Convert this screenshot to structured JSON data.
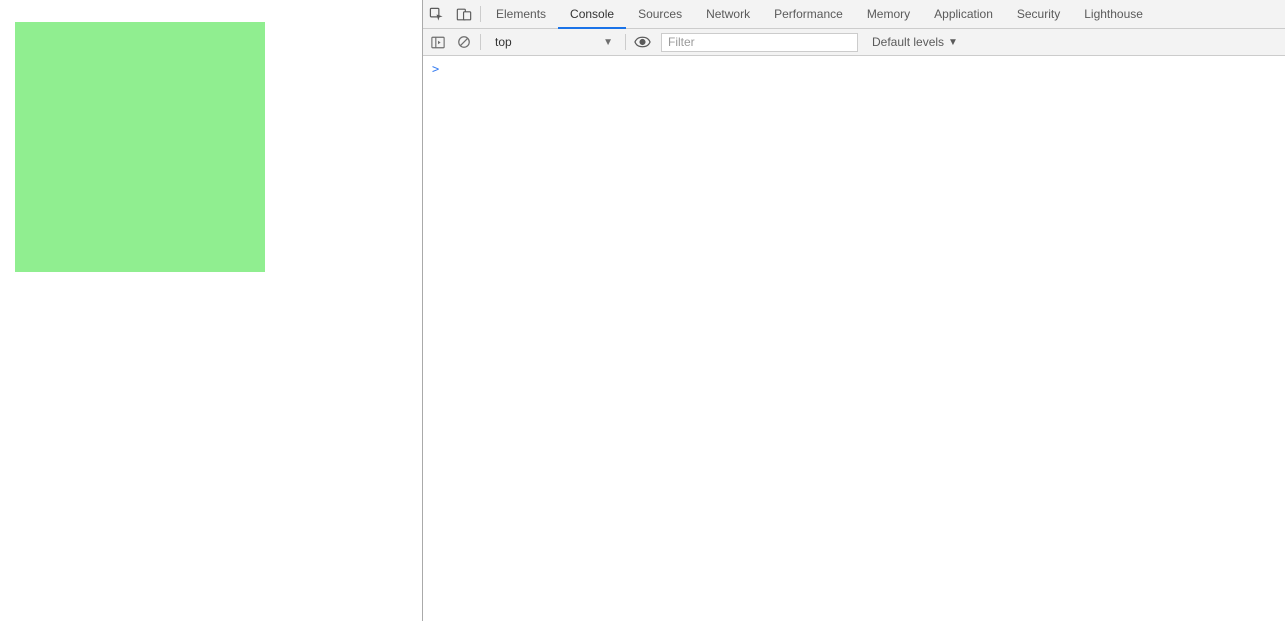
{
  "page": {
    "box_color": "#90ee90"
  },
  "devtools": {
    "tabs": [
      {
        "label": "Elements"
      },
      {
        "label": "Console"
      },
      {
        "label": "Sources"
      },
      {
        "label": "Network"
      },
      {
        "label": "Performance"
      },
      {
        "label": "Memory"
      },
      {
        "label": "Application"
      },
      {
        "label": "Security"
      },
      {
        "label": "Lighthouse"
      }
    ],
    "active_tab": "Console",
    "toolbar": {
      "context": "top",
      "filter_placeholder": "Filter",
      "levels_label": "Default levels"
    },
    "prompt_symbol": ">"
  }
}
